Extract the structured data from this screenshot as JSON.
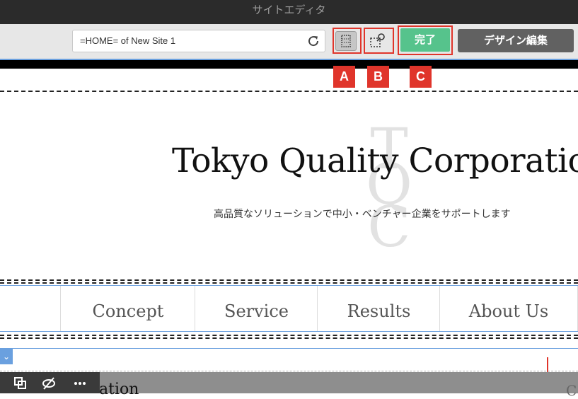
{
  "window": {
    "title": "サイトエディタ"
  },
  "toolbar": {
    "url_value": "=HOME= of New Site 1",
    "done_label": "完了",
    "design_edit_label": "デザイン編集"
  },
  "callouts": [
    "A",
    "B",
    "C"
  ],
  "site": {
    "logo_letters": "TQC",
    "title": "Tokyo Quality Corporatio",
    "subtitle": "高品質なソリューションで中小・ベンチャー企業をサポートします",
    "nav": [
      "Concept",
      "Service",
      "Results",
      "About Us"
    ]
  },
  "bottom": {
    "partial_heading": "ation",
    "partial_right": "C"
  },
  "colors": {
    "highlight": "#e0352b",
    "done_button": "#56c38c",
    "selection_blue": "#6aa0df"
  }
}
